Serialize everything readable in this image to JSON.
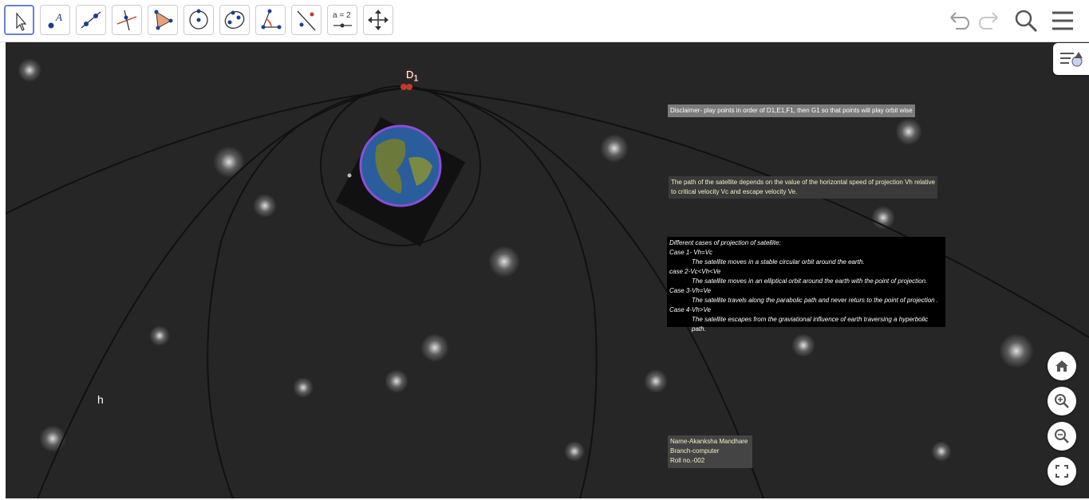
{
  "toolbar": {
    "tools": [
      "move-tool",
      "point-tool",
      "line-tool",
      "perpendicular-line-tool",
      "polygon-tool",
      "circle-tool",
      "conic-tool",
      "angle-tool",
      "reflect-tool",
      "slider-tool",
      "move-view-tool"
    ],
    "slider_label": "a = 2",
    "right_icons": [
      "undo-icon",
      "redo-icon",
      "search-icon",
      "menu-icon"
    ]
  },
  "canvas": {
    "point_label": "D",
    "point_sub": "1",
    "label_h": "h",
    "disclaimer": "Disclaimer- play points in order of D1,E1,F1, then G1 so that points will play orbit wise",
    "path_text_1": "The path of the satellite depends on the value of the horizontal speed of projection Vh relative",
    "path_text_2": " to critical velocity Vc and escape velocity Ve.",
    "cases": {
      "title": "Different cases of projection of satellite:",
      "c1": "Case 1- Vh=Vc",
      "c1d": "The satellite moves in a stable circular orbit around the earth.",
      "c2": "case 2-Vc<Vh<Ve",
      "c2d": "The satellite moves in an elliptical orbit around the earth with the point of projection.",
      "c3": " Case 3-Vh=Ve",
      "c3d": "The satellite travels along the parabolic path and never returs to the point of projection .",
      "c4": "Case 4-Vh>Ve",
      "c4d": "The satellite escapes from the graviational influence of earth traversing a hyperbolic path."
    },
    "author": {
      "name": "Name-Akanksha Mandhare",
      "branch": "Branch-computer",
      "roll": "Roll no.-002"
    }
  },
  "colors": {
    "accent": "#6a7fd6",
    "canvas_bg": "#262626",
    "earth_ring": "#8a4fd6",
    "point": "#c0392b"
  },
  "view_controls": [
    "home-icon",
    "zoom-in-icon",
    "zoom-out-icon",
    "fullscreen-icon"
  ]
}
